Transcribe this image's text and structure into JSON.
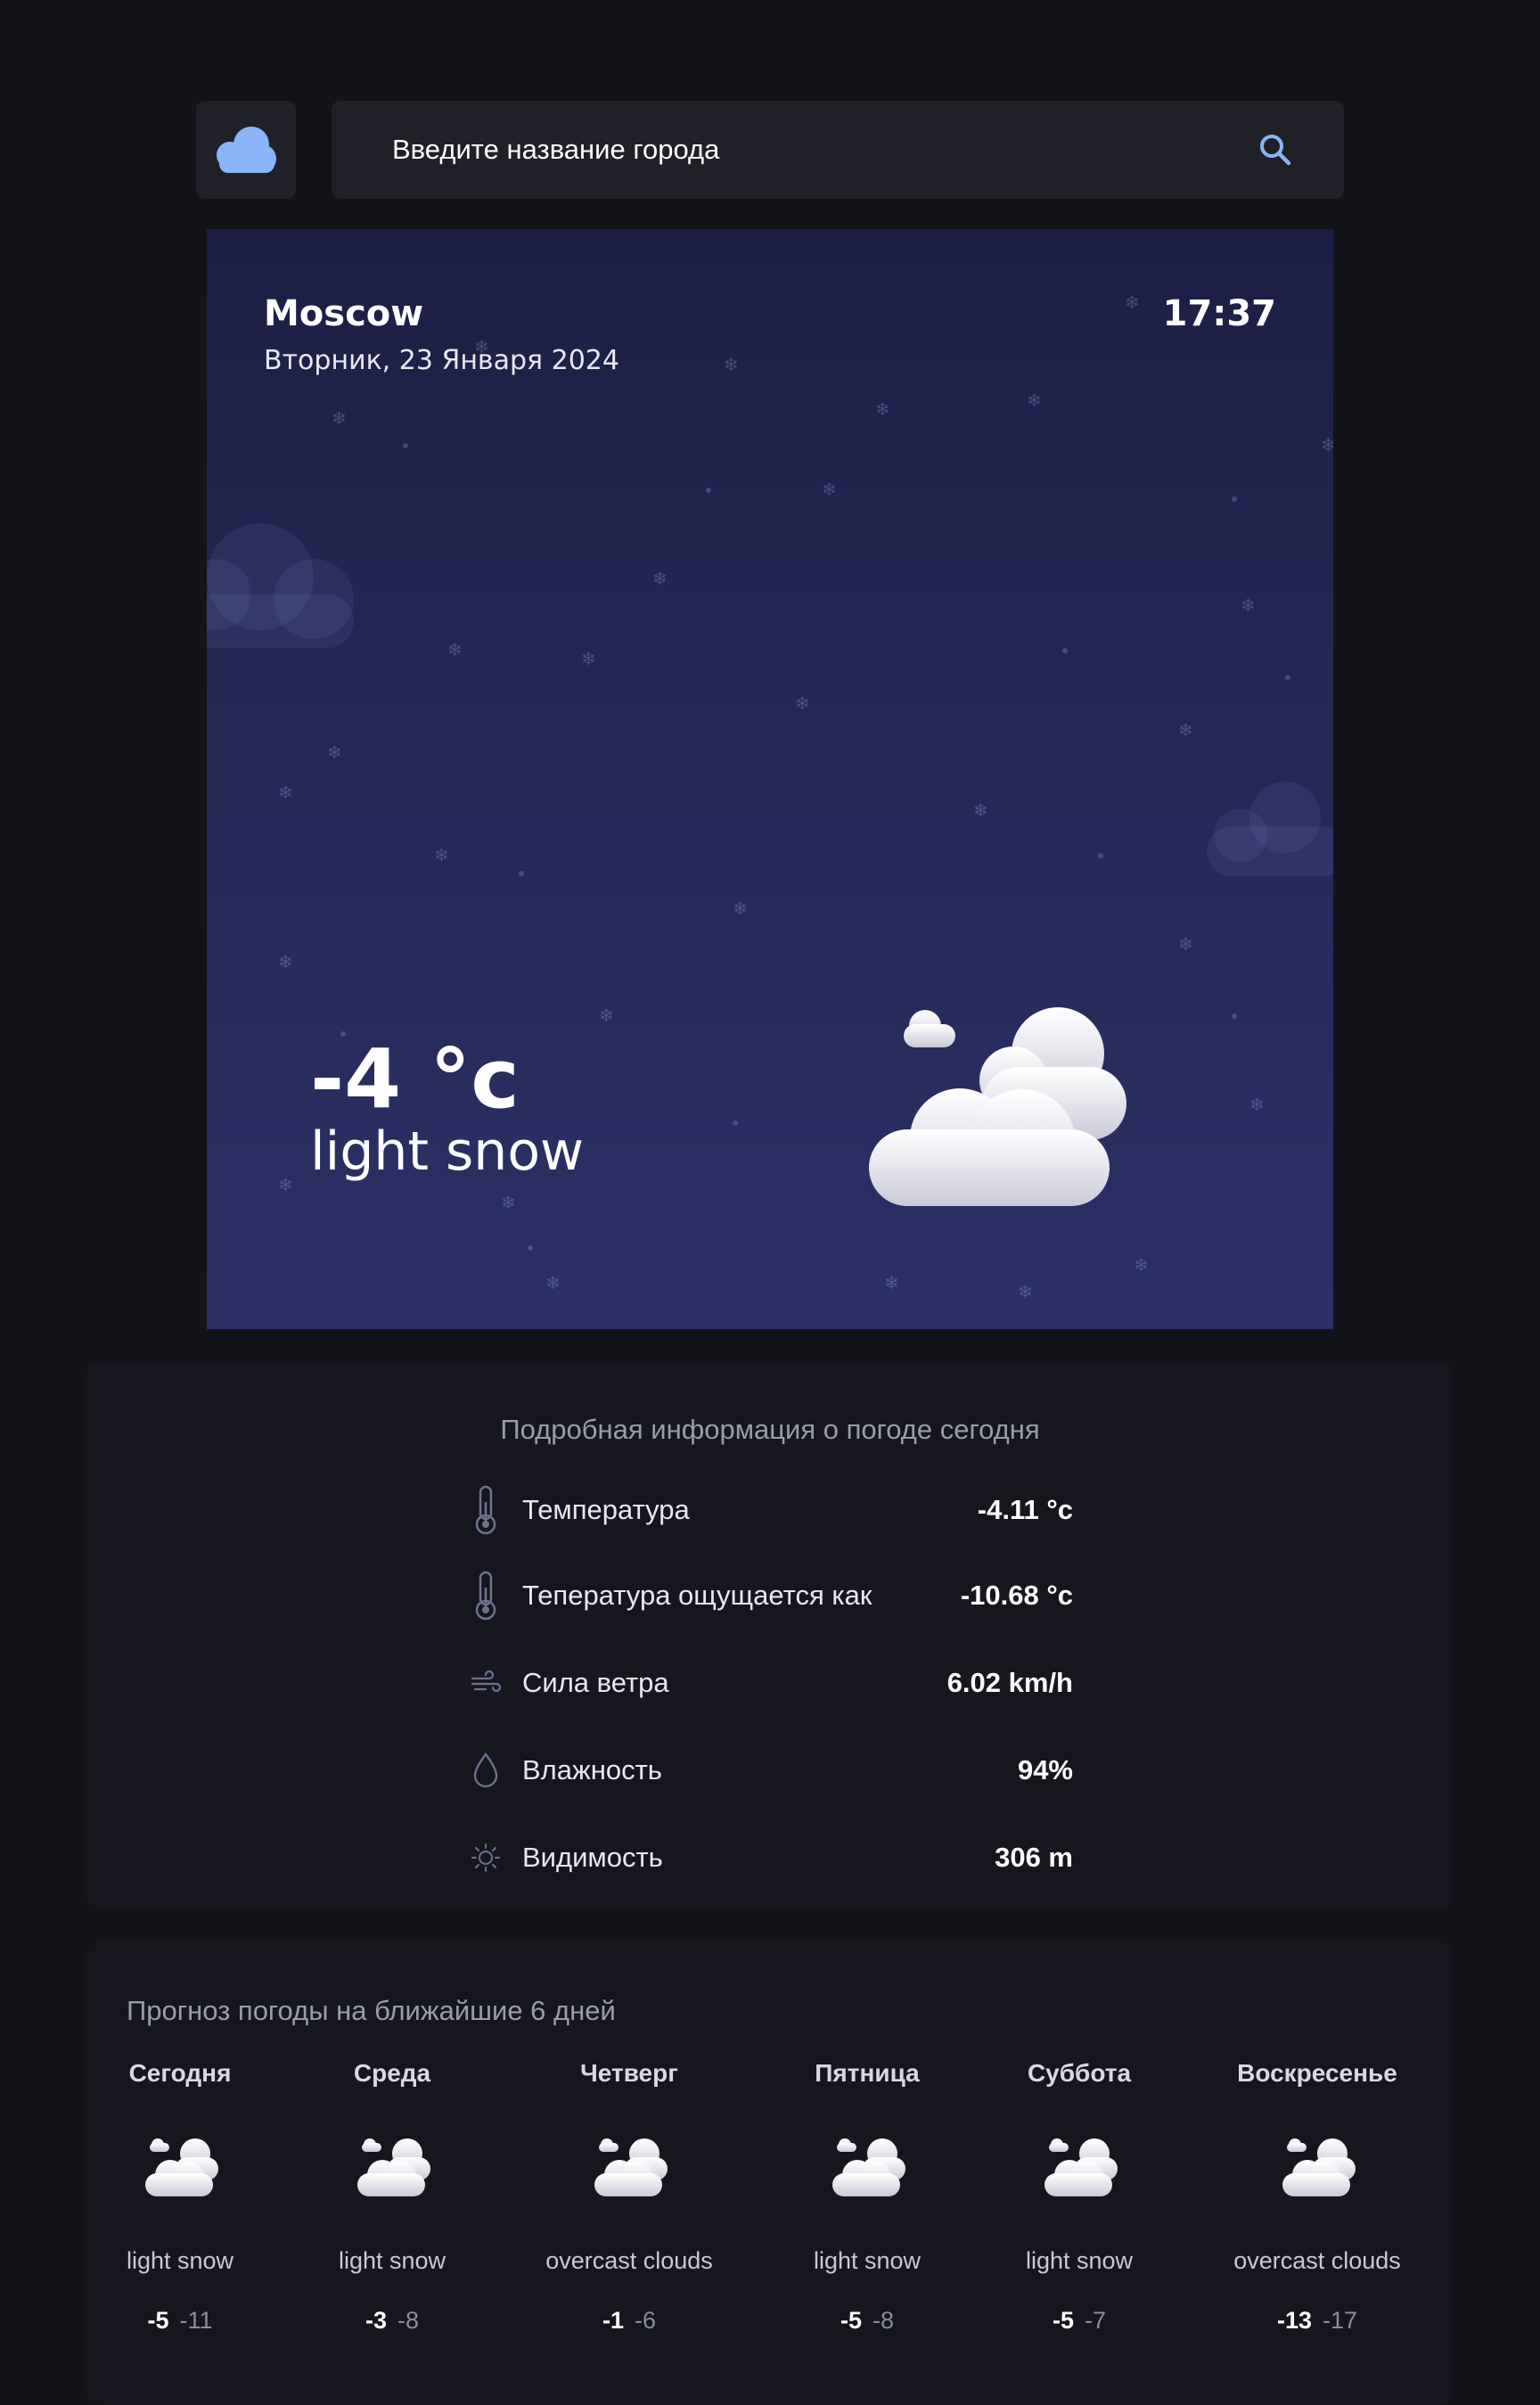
{
  "header": {
    "logo_icon": "cloud-logo-icon",
    "search": {
      "placeholder": "Введите название города",
      "icon": "search-icon",
      "accent": "#8ab4f8"
    }
  },
  "current": {
    "city": "Moscow",
    "date": "Вторник, 23 Января 2024",
    "time": "17:37",
    "temperature": "-4 °c",
    "description": "light snow",
    "icon": "snow-clouds-icon"
  },
  "details": {
    "title": "Подробная информация о погоде сегодня",
    "rows": [
      {
        "icon": "thermometer-icon",
        "label": "Температура",
        "value": "-4.11 °c"
      },
      {
        "icon": "thermometer-icon",
        "label": "Тепература ощущается как",
        "value": "-10.68 °c"
      },
      {
        "icon": "wind-icon",
        "label": "Сила ветра",
        "value": "6.02 km/h"
      },
      {
        "icon": "droplet-icon",
        "label": "Влажность",
        "value": "94%"
      },
      {
        "icon": "sun-icon",
        "label": "Видимость",
        "value": "306 m"
      }
    ]
  },
  "forecast": {
    "title": "Прогноз погоды на ближайшие 6 дней",
    "days": [
      {
        "name": "Сегодня",
        "desc": "light snow",
        "hi": "-5",
        "lo": "-11"
      },
      {
        "name": "Среда",
        "desc": "light snow",
        "hi": "-3",
        "lo": "-8"
      },
      {
        "name": "Четверг",
        "desc": "overcast clouds",
        "hi": "-1",
        "lo": "-6"
      },
      {
        "name": "Пятница",
        "desc": "light snow",
        "hi": "-5",
        "lo": "-8"
      },
      {
        "name": "Суббота",
        "desc": "light snow",
        "hi": "-5",
        "lo": "-7"
      },
      {
        "name": "Воскресенье",
        "desc": "overcast clouds",
        "hi": "-13",
        "lo": "-17"
      }
    ]
  }
}
